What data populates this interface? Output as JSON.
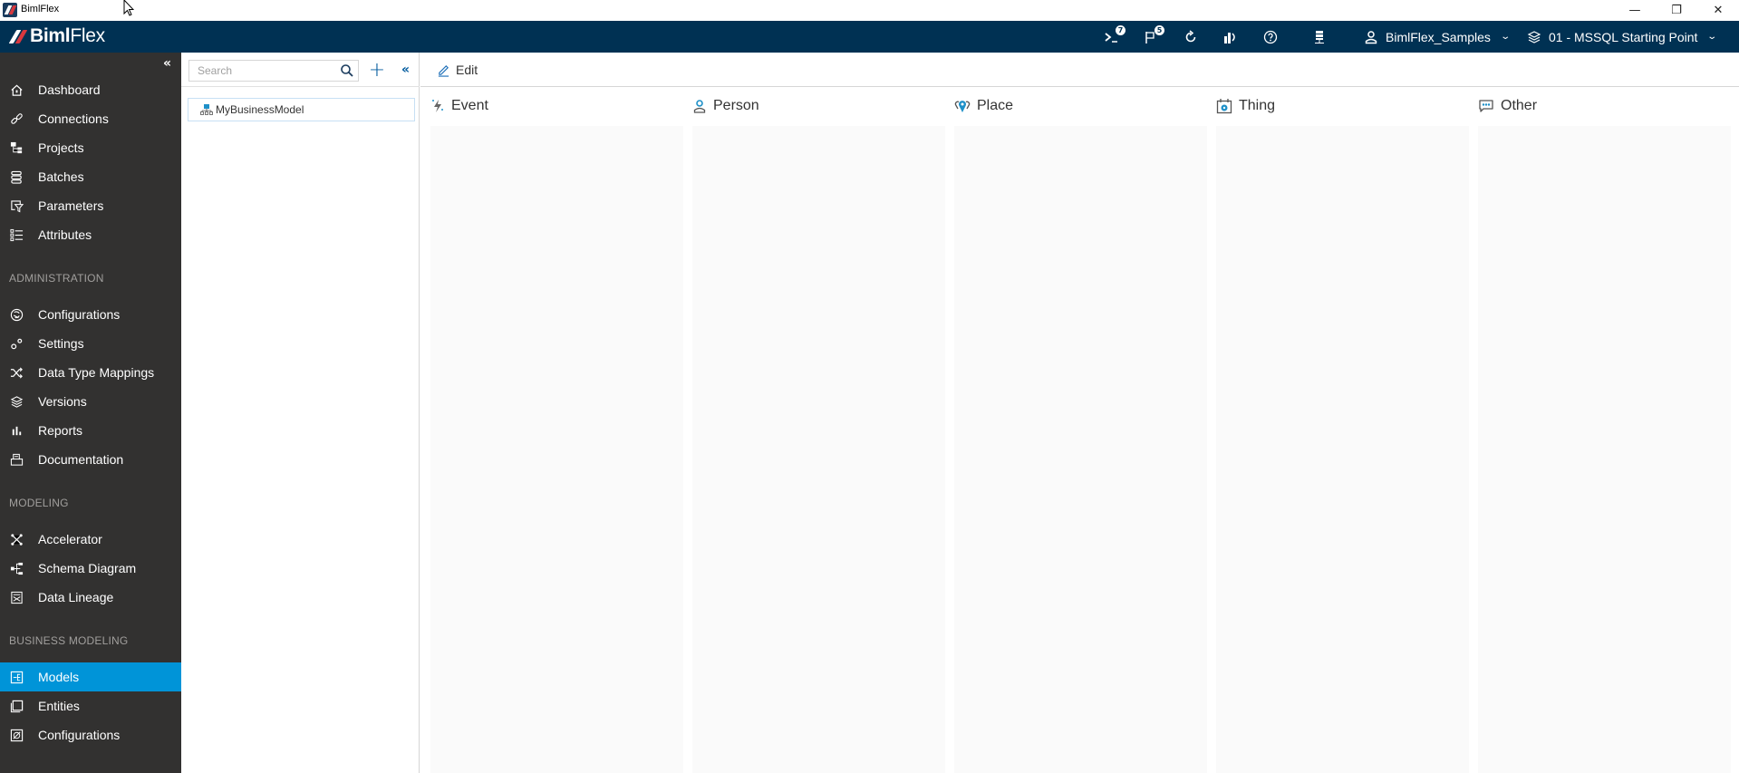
{
  "window": {
    "title": "BimlFlex",
    "controls": {
      "minimize": "—",
      "maximize": "❐",
      "close": "✕"
    }
  },
  "header": {
    "logo_bold": "Biml",
    "logo_light": "Flex",
    "icons": [
      {
        "name": "console-icon",
        "badge": "7"
      },
      {
        "name": "flag-icon",
        "badge": "5"
      },
      {
        "name": "refresh-icon",
        "badge": null
      },
      {
        "name": "analytics-icon",
        "badge": null
      },
      {
        "name": "help-icon",
        "badge": null
      },
      {
        "name": "server-icon",
        "badge": null
      }
    ],
    "customer": "BimlFlex_Samples",
    "version": "01 - MSSQL Starting Point"
  },
  "sidebar": {
    "collapse_glyph": "«",
    "items": [
      {
        "label": "Dashboard",
        "icon": "home-icon"
      },
      {
        "label": "Connections",
        "icon": "link-icon"
      },
      {
        "label": "Projects",
        "icon": "projects-icon"
      },
      {
        "label": "Batches",
        "icon": "batches-icon"
      },
      {
        "label": "Parameters",
        "icon": "parameters-icon"
      },
      {
        "label": "Attributes",
        "icon": "attributes-icon"
      }
    ],
    "sections": [
      {
        "title": "ADMINISTRATION",
        "items": [
          {
            "label": "Configurations",
            "icon": "configurations-icon"
          },
          {
            "label": "Settings",
            "icon": "settings-icon"
          },
          {
            "label": "Data Type Mappings",
            "icon": "shuffle-icon"
          },
          {
            "label": "Versions",
            "icon": "layers-icon"
          },
          {
            "label": "Reports",
            "icon": "bar-chart-icon"
          },
          {
            "label": "Documentation",
            "icon": "printer-icon"
          }
        ]
      },
      {
        "title": "MODELING",
        "items": [
          {
            "label": "Accelerator",
            "icon": "accelerator-icon"
          },
          {
            "label": "Schema Diagram",
            "icon": "schema-icon"
          },
          {
            "label": "Data Lineage",
            "icon": "lineage-icon"
          }
        ]
      },
      {
        "title": "BUSINESS MODELING",
        "items": [
          {
            "label": "Models",
            "icon": "models-icon",
            "active": true
          },
          {
            "label": "Entities",
            "icon": "entities-icon"
          },
          {
            "label": "Configurations",
            "icon": "business-configurations-icon"
          }
        ]
      }
    ],
    "active_color": "#0094d8"
  },
  "tree": {
    "search_placeholder": "Search",
    "search_value": "",
    "add_glyph": "+",
    "collapse_glyph": "«",
    "nodes": [
      {
        "label": "MyBusinessModel"
      }
    ]
  },
  "main": {
    "edit_label": "Edit",
    "columns": [
      {
        "label": "Event",
        "icon": "event-icon"
      },
      {
        "label": "Person",
        "icon": "person-icon"
      },
      {
        "label": "Place",
        "icon": "place-icon"
      },
      {
        "label": "Thing",
        "icon": "thing-icon"
      },
      {
        "label": "Other",
        "icon": "other-icon"
      }
    ]
  },
  "colors": {
    "header_bg": "#003153",
    "sidebar_bg": "#323130",
    "accent": "#0094d8",
    "icon_blue": "#1e90c8"
  }
}
